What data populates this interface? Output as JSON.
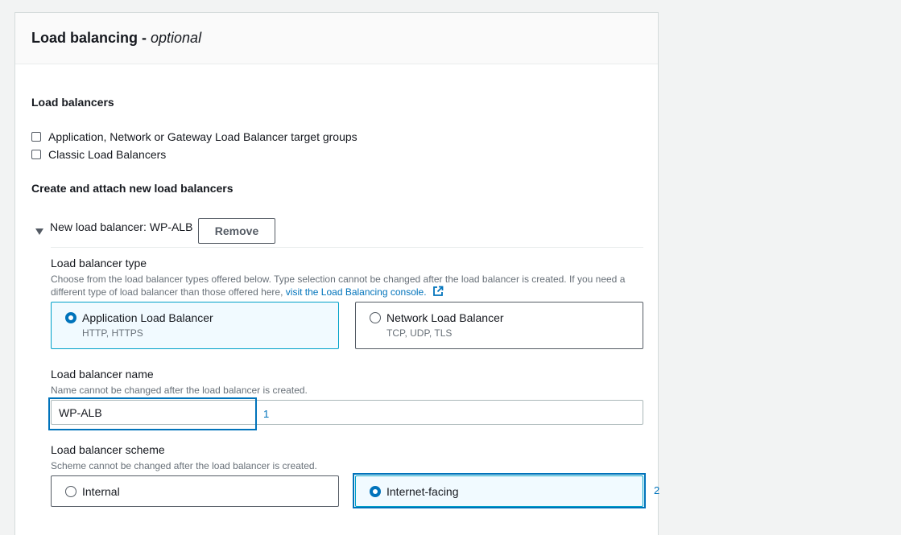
{
  "section": {
    "title": "Load balancing - ",
    "title_optional": "optional"
  },
  "load_balancers": {
    "label": "Load balancers",
    "options": [
      {
        "label": "Application, Network or Gateway Load Balancer target groups",
        "checked": false
      },
      {
        "label": "Classic Load Balancers",
        "checked": false
      }
    ]
  },
  "create_attach": {
    "label": "Create and attach new load balancers",
    "new_lb_title": "New load balancer: WP-ALB",
    "remove_label": "Remove"
  },
  "lb_type": {
    "label": "Load balancer type",
    "description": "Choose from the load balancer types offered below. Type selection cannot be changed after the load balancer is created. If you need a different type of load balancer than those offered here,",
    "link_text": "visit the Load Balancing console.",
    "options": [
      {
        "title": "Application Load Balancer",
        "sub": "HTTP, HTTPS",
        "selected": true
      },
      {
        "title": "Network Load Balancer",
        "sub": "TCP, UDP, TLS",
        "selected": false
      }
    ]
  },
  "lb_name": {
    "label": "Load balancer name",
    "description": "Name cannot be changed after the load balancer is created.",
    "value": "WP-ALB"
  },
  "lb_scheme": {
    "label": "Load balancer scheme",
    "description": "Scheme cannot be changed after the load balancer is created.",
    "options": [
      {
        "title": "Internal",
        "selected": false
      },
      {
        "title": "Internet-facing",
        "selected": true
      }
    ]
  },
  "markers": [
    "1",
    "2"
  ],
  "colors": {
    "accent": "#0073bb",
    "selected_border": "#00a1c9",
    "selected_bg": "#f1faff",
    "page_bg": "#f2f3f3"
  }
}
